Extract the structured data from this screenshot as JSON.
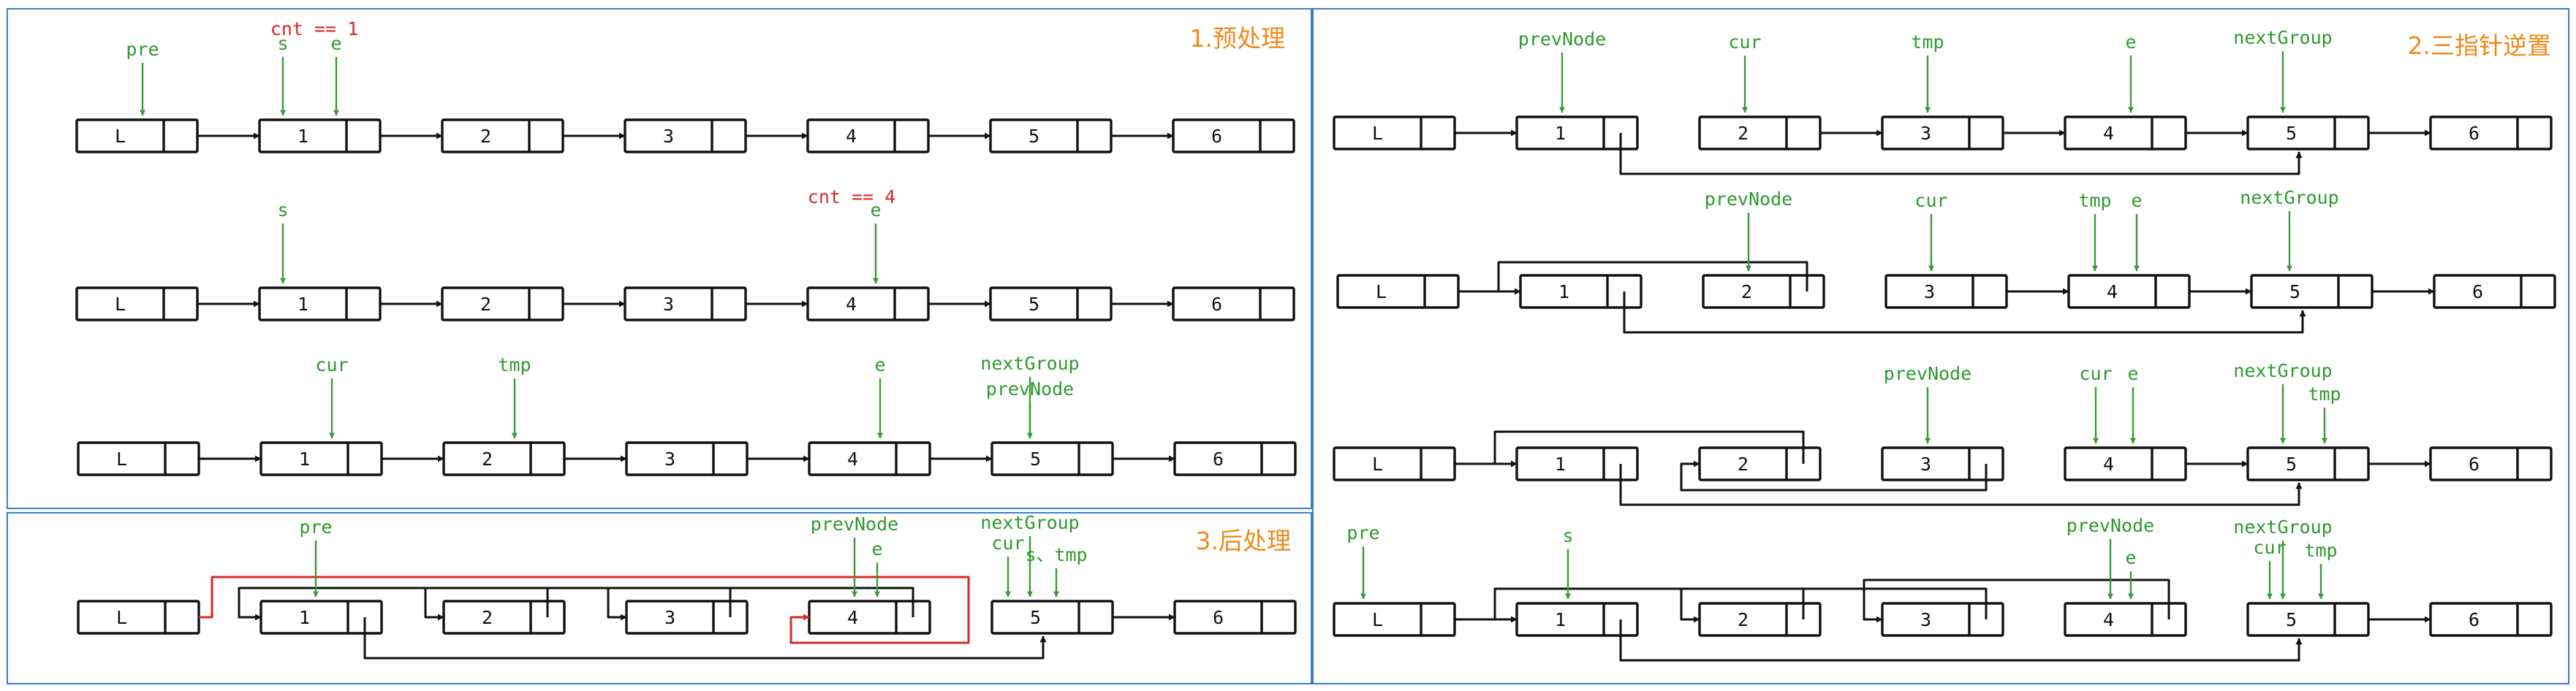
{
  "colors": {
    "frame": "#3d7dc8",
    "node": "#111111",
    "pointer": "#2f9a2f",
    "counter": "#d42a2a",
    "title": "#ee8a1a",
    "highlight_link": "#d42a2a"
  },
  "panels": [
    {
      "id": "p1",
      "title": "1.预处理",
      "rows": [
        {
          "nodes": [
            "L",
            "1",
            "2",
            "3",
            "4",
            "5",
            "6"
          ],
          "pointers": [
            {
              "label": "pre",
              "node": 0
            },
            {
              "label": "s",
              "node": 1
            },
            {
              "label": "e",
              "node": 1
            }
          ],
          "notes": [
            {
              "text": "cnt == 1",
              "node": 1
            }
          ]
        },
        {
          "nodes": [
            "L",
            "1",
            "2",
            "3",
            "4",
            "5",
            "6"
          ],
          "pointers": [
            {
              "label": "s",
              "node": 1
            },
            {
              "label": "e",
              "node": 4
            }
          ],
          "notes": [
            {
              "text": "cnt == 4",
              "node": 4
            }
          ]
        },
        {
          "nodes": [
            "L",
            "1",
            "2",
            "3",
            "4",
            "5",
            "6"
          ],
          "pointers": [
            {
              "label": "cur",
              "node": 1
            },
            {
              "label": "tmp",
              "node": 2
            },
            {
              "label": "e",
              "node": 4
            },
            {
              "label": "nextGroup",
              "node": 5
            },
            {
              "label": "prevNode",
              "node": 5
            }
          ],
          "notes": []
        }
      ]
    },
    {
      "id": "p2",
      "title": "2.三指针逆置",
      "rows": [
        {
          "nodes": [
            "L",
            "1",
            "2",
            "3",
            "4",
            "5",
            "6"
          ],
          "pointers": [
            {
              "label": "prevNode",
              "node": 1
            },
            {
              "label": "cur",
              "node": 2
            },
            {
              "label": "tmp",
              "node": 3
            },
            {
              "label": "e",
              "node": 4
            },
            {
              "label": "nextGroup",
              "node": 5
            }
          ]
        },
        {
          "nodes": [
            "L",
            "1",
            "2",
            "3",
            "4",
            "5",
            "6"
          ],
          "pointers": [
            {
              "label": "prevNode",
              "node": 2
            },
            {
              "label": "cur",
              "node": 3
            },
            {
              "label": "tmp",
              "node": 4
            },
            {
              "label": "e",
              "node": 4
            },
            {
              "label": "nextGroup",
              "node": 5
            }
          ]
        },
        {
          "nodes": [
            "L",
            "1",
            "2",
            "3",
            "4",
            "5",
            "6"
          ],
          "pointers": [
            {
              "label": "prevNode",
              "node": 3
            },
            {
              "label": "cur",
              "node": 4
            },
            {
              "label": "e",
              "node": 4
            },
            {
              "label": "nextGroup",
              "node": 5
            },
            {
              "label": "tmp",
              "node": 5
            }
          ]
        },
        {
          "nodes": [
            "L",
            "1",
            "2",
            "3",
            "4",
            "5",
            "6"
          ],
          "pointers": [
            {
              "label": "pre",
              "node": 0
            },
            {
              "label": "s",
              "node": 1
            },
            {
              "label": "prevNode",
              "node": 4
            },
            {
              "label": "e",
              "node": 4
            },
            {
              "label": "nextGroup",
              "node": 5
            },
            {
              "label": "cur",
              "node": 5
            },
            {
              "label": "tmp",
              "node": 5
            }
          ]
        }
      ]
    },
    {
      "id": "p3",
      "title": "3.后处理",
      "rows": [
        {
          "nodes": [
            "L",
            "1",
            "2",
            "3",
            "4",
            "5",
            "6"
          ],
          "pointers": [
            {
              "label": "pre",
              "node": 1
            },
            {
              "label": "prevNode",
              "node": 4
            },
            {
              "label": "e",
              "node": 4
            },
            {
              "label": "nextGroup",
              "node": 5
            },
            {
              "label": "cur",
              "node": 5
            },
            {
              "label": "s、tmp",
              "node": 5
            }
          ]
        }
      ]
    }
  ]
}
